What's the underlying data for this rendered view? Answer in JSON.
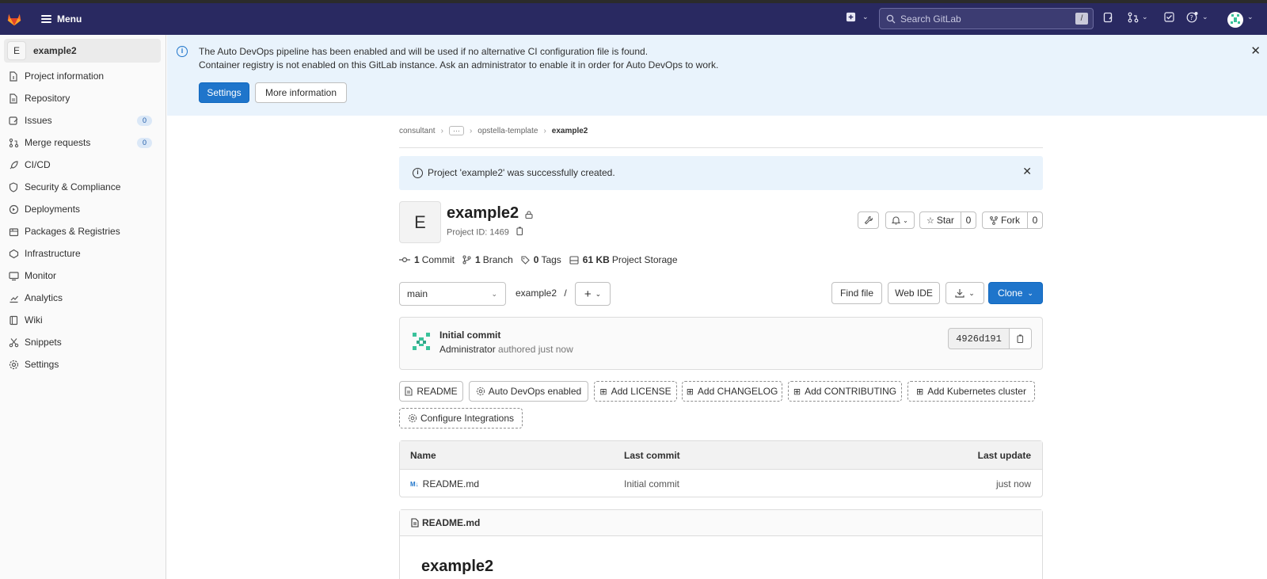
{
  "header": {
    "menu_label": "Menu",
    "search_placeholder": "Search GitLab",
    "search_shortcut": "/"
  },
  "sidebar": {
    "project_initial": "E",
    "project_name": "example2",
    "items": [
      {
        "label": "Project information",
        "icon": "info-document-icon"
      },
      {
        "label": "Repository",
        "icon": "document-icon"
      },
      {
        "label": "Issues",
        "icon": "issues-icon",
        "badge": "0"
      },
      {
        "label": "Merge requests",
        "icon": "merge-request-icon",
        "badge": "0"
      },
      {
        "label": "CI/CD",
        "icon": "rocket-icon"
      },
      {
        "label": "Security & Compliance",
        "icon": "shield-icon"
      },
      {
        "label": "Deployments",
        "icon": "deployments-icon"
      },
      {
        "label": "Packages & Registries",
        "icon": "package-icon"
      },
      {
        "label": "Infrastructure",
        "icon": "cloud-icon"
      },
      {
        "label": "Monitor",
        "icon": "monitor-icon"
      },
      {
        "label": "Analytics",
        "icon": "chart-icon"
      },
      {
        "label": "Wiki",
        "icon": "book-icon"
      },
      {
        "label": "Snippets",
        "icon": "scissors-icon"
      },
      {
        "label": "Settings",
        "icon": "gear-icon"
      }
    ]
  },
  "banner": {
    "line1": "The Auto DevOps pipeline has been enabled and will be used if no alternative CI configuration file is found.",
    "line2": "Container registry is not enabled on this GitLab instance. Ask an administrator to enable it in order for Auto DevOps to work.",
    "settings_button": "Settings",
    "more_info_button": "More information"
  },
  "breadcrumb": {
    "items": [
      "consultant",
      "opstella-template"
    ],
    "current": "example2"
  },
  "alert": {
    "text": "Project 'example2' was successfully created."
  },
  "project": {
    "initial": "E",
    "name": "example2",
    "id_label": "Project ID: 1469",
    "star_label": "Star",
    "star_count": "0",
    "fork_label": "Fork",
    "fork_count": "0"
  },
  "stats": {
    "commits_count": "1",
    "commits_label": "Commit",
    "branches_count": "1",
    "branches_label": "Branch",
    "tags_count": "0",
    "tags_label": "Tags",
    "storage_size": "61 KB",
    "storage_label": "Project Storage"
  },
  "repo_nav": {
    "branch": "main",
    "path": "example2",
    "path_sep": "/",
    "find_file": "Find file",
    "web_ide": "Web IDE",
    "clone": "Clone"
  },
  "commit": {
    "title": "Initial commit",
    "author": "Administrator",
    "meta": "authored just now",
    "sha": "4926d191"
  },
  "quick_buttons": {
    "readme": "README",
    "auto_devops": "Auto DevOps enabled",
    "license": "Add LICENSE",
    "changelog": "Add CHANGELOG",
    "contributing": "Add CONTRIBUTING",
    "kubernetes": "Add Kubernetes cluster",
    "integrations": "Configure Integrations"
  },
  "file_table": {
    "headers": {
      "name": "Name",
      "last_commit": "Last commit",
      "last_update": "Last update"
    },
    "rows": [
      {
        "name": "README.md",
        "last_commit": "Initial commit",
        "last_update": "just now"
      }
    ]
  },
  "readme": {
    "file_name": "README.md",
    "title": "example2"
  },
  "colors": {
    "header_bg": "#292961",
    "accent": "#1f75cb",
    "banner_bg": "#e9f3fc"
  }
}
